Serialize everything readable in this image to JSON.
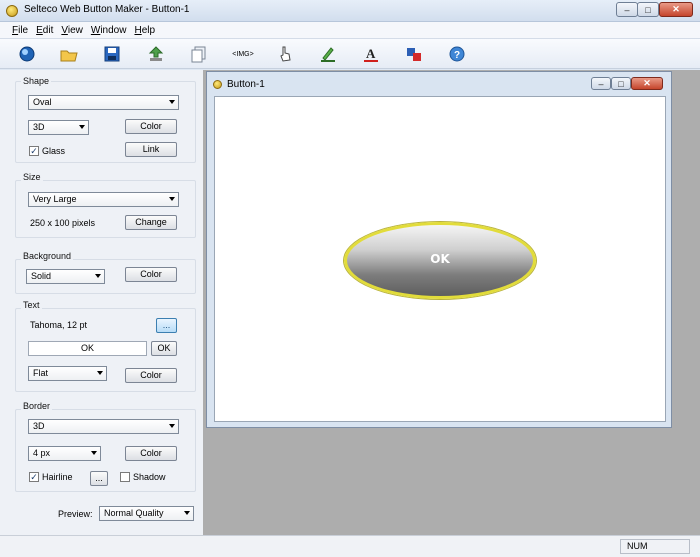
{
  "window": {
    "title": "Selteco Web Button Maker - Button-1"
  },
  "menu": [
    {
      "label": "File",
      "underline": "F",
      "rest": "ile"
    },
    {
      "label": "Edit",
      "underline": "E",
      "rest": "dit"
    },
    {
      "label": "View",
      "underline": "V",
      "rest": "iew"
    },
    {
      "label": "Window",
      "underline": "W",
      "rest": "indow"
    },
    {
      "label": "Help",
      "underline": "H",
      "rest": "elp"
    }
  ],
  "toolbar": {
    "img_label": "<IMG>"
  },
  "shape": {
    "label": "Shape",
    "value": "Oval",
    "style": "3D",
    "color_btn": "Color",
    "glass_label": "Glass",
    "glass_checked": true,
    "link_btn": "Link"
  },
  "size": {
    "label": "Size",
    "value": "Very Large",
    "dims": "250 x 100 pixels",
    "change_btn": "Change"
  },
  "background": {
    "label": "Background",
    "value": "Solid",
    "color_btn": "Color"
  },
  "text": {
    "label": "Text",
    "font": "Tahoma, 12 pt",
    "font_btn": "...",
    "input_value": "OK",
    "ok_btn": "OK",
    "style": "Flat",
    "color_btn": "Color"
  },
  "border": {
    "label": "Border",
    "style": "3D",
    "width": "4 px",
    "color_btn": "Color",
    "hairline_label": "Hairline",
    "hairline_checked": true,
    "more_btn": "...",
    "shadow_label": "Shadow",
    "shadow_checked": false
  },
  "preview": {
    "label": "Preview:",
    "value": "Normal Quality"
  },
  "document": {
    "title": "Button-1",
    "button_text": "OK"
  },
  "status": {
    "num": "NUM"
  },
  "colors": {
    "border_yellow": "#e2dc3a",
    "workspace": "#adadad"
  }
}
